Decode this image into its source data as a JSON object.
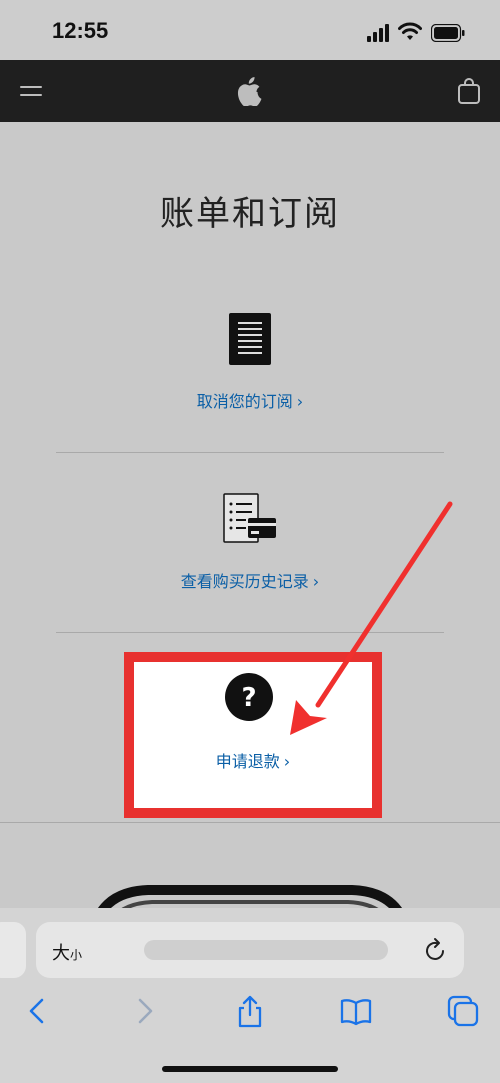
{
  "status": {
    "time": "12:55"
  },
  "page": {
    "title": "账单和订阅"
  },
  "links": {
    "cancel_subscription": "取消您的订阅",
    "purchase_history": "查看购买历史记录",
    "request_refund": "申请退款",
    "chevron": "›"
  },
  "help_symbol": "?",
  "browser": {
    "text_size_big": "大",
    "text_size_small": "小"
  },
  "colors": {
    "link": "#0b5fa6",
    "highlight": "#e8312f",
    "nav_bg": "#1f1f1f",
    "browser_accent": "#1a73e8"
  },
  "icons": [
    "menu-icon",
    "apple-logo-icon",
    "bag-icon",
    "document-icon",
    "purchase-history-icon",
    "help-icon",
    "reload-icon",
    "back-icon",
    "forward-icon",
    "share-icon",
    "bookmarks-icon",
    "tabs-icon"
  ]
}
